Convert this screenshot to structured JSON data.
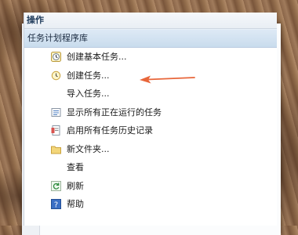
{
  "panel": {
    "header": "操作",
    "section": "任务计划程序库",
    "items": [
      {
        "label": "创建基本任务...",
        "icon": "clock-wizard-icon"
      },
      {
        "label": "创建任务...",
        "icon": "clock-icon"
      },
      {
        "label": "导入任务...",
        "icon": ""
      },
      {
        "label": "显示所有正在运行的任务",
        "icon": "running-tasks-icon"
      },
      {
        "label": "启用所有任务历史记录",
        "icon": "history-icon"
      },
      {
        "label": "新文件夹...",
        "icon": "folder-icon"
      },
      {
        "label": "查看",
        "icon": ""
      },
      {
        "label": "刷新",
        "icon": "refresh-icon"
      },
      {
        "label": "帮助",
        "icon": "help-icon"
      }
    ]
  },
  "colors": {
    "accent_arrow": "#e8663a",
    "section_bg": "#d3e3f2",
    "header_text": "#1e3a5a"
  }
}
